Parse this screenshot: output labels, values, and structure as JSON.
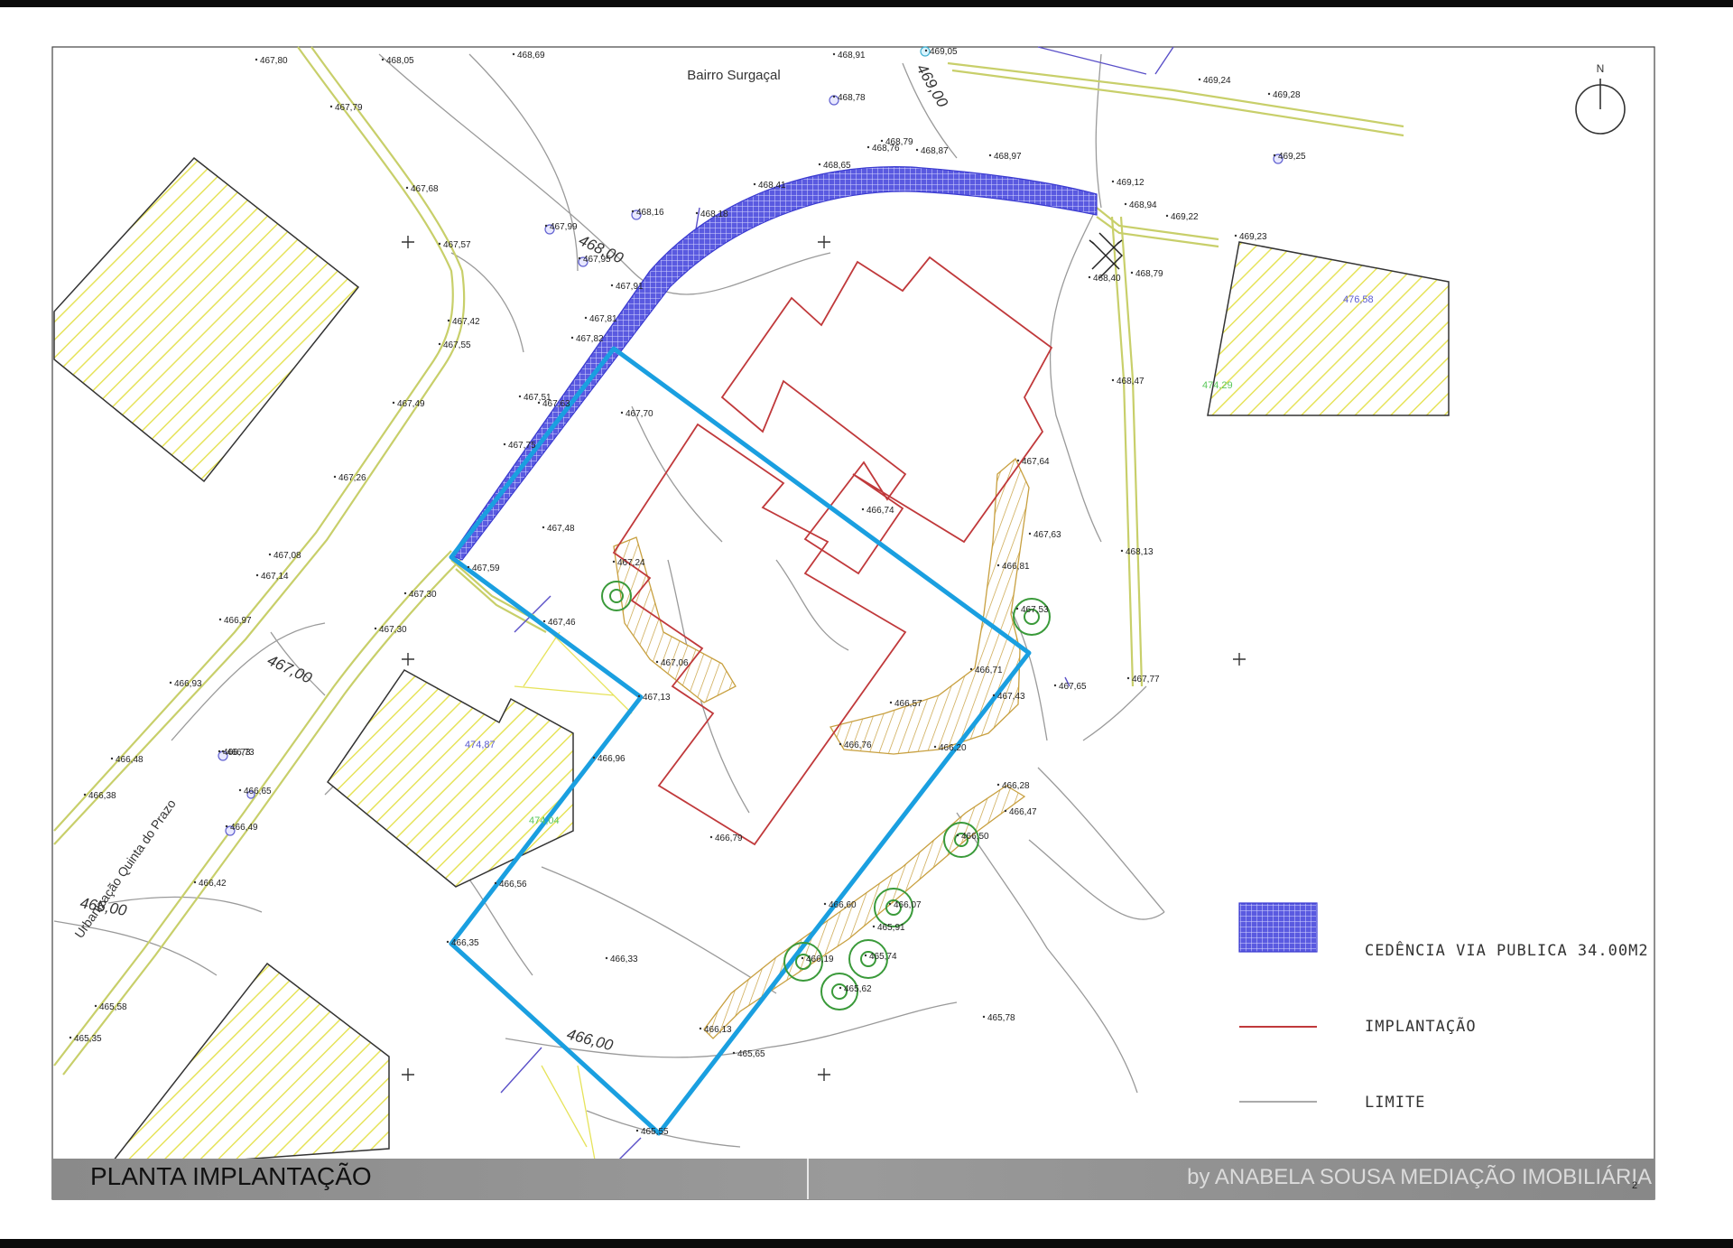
{
  "map": {
    "title": "PLANTA IMPLANTAÇÃO",
    "watermark": "by ANABELA SOUSA MEDIAÇÃO IMOBILIÁRIA",
    "page_number": "2",
    "north_label": "N",
    "places": {
      "bairro": "Bairro Surgaçal",
      "urbanizacao": "Urbanização Quinta do Prazo"
    },
    "contours": [
      "469,00",
      "468,00",
      "467,00",
      "466,00",
      "466,00"
    ],
    "building_heights": [
      "476,58",
      "474,29",
      "474,87",
      "474,04"
    ],
    "legend": {
      "cedencia": "CEDÊNCIA VIA PUBLICA 34.00M2",
      "implantacao": "IMPLANTAÇÃO",
      "limite": "LIMITE"
    },
    "colors": {
      "boundary": "#1a9fe0",
      "implantacao": "#c0393b",
      "cedencia": "#3a3ad0",
      "hatch": "#e6e35a",
      "slope": "#c8a040",
      "tree": "#3a9a3a"
    },
    "elevations": [
      "467,80",
      "468,05",
      "468,69",
      "468,91",
      "469,05",
      "469,24",
      "469,28",
      "467,79",
      "468,78",
      "468,79",
      "468,76",
      "468,87",
      "468,97",
      "469,25",
      "468,65",
      "468,41",
      "469,12",
      "468,94",
      "469,22",
      "469,23",
      "467,68",
      "467,99",
      "468,16",
      "468,18",
      "467,57",
      "467,95",
      "468,40",
      "468,79",
      "467,91",
      "467,42",
      "467,55",
      "467,81",
      "467,82",
      "468,47",
      "467,49",
      "467,63",
      "467,51",
      "467,70",
      "467,26",
      "467,75",
      "467,64",
      "466,74",
      "467,48",
      "467,63",
      "468,13",
      "467,08",
      "467,14",
      "466,73",
      "467,59",
      "467,24",
      "466,81",
      "467,30",
      "466,97",
      "467,30",
      "467,46",
      "467,53",
      "466,93",
      "467,06",
      "467,13",
      "466,71",
      "467,43",
      "467,65",
      "467,77",
      "466,57",
      "466,73",
      "466,48",
      "466,65",
      "466,96",
      "466,76",
      "466,20",
      "466,38",
      "466,49",
      "466,28",
      "466,47",
      "466,42",
      "466,79",
      "466,50",
      "466,56",
      "466,60",
      "466,07",
      "465,91",
      "466,35",
      "466,33",
      "466,19",
      "465,74",
      "465,62",
      "465,58",
      "465,35",
      "465,78",
      "466,13",
      "465,65",
      "465,55"
    ]
  }
}
